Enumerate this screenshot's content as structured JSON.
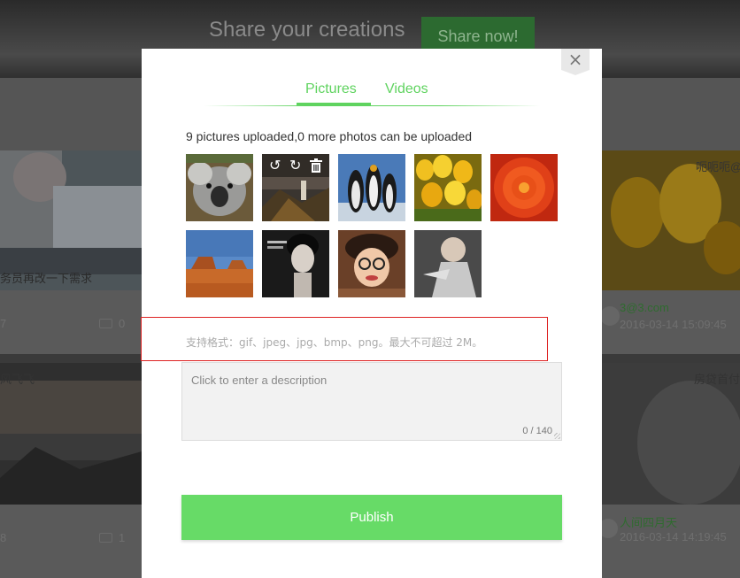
{
  "background": {
    "banner_title": "Share your creations",
    "banner_button": "Share now!",
    "card_left_top_caption": "务员再改一下需求",
    "card_left_top_comments": "0",
    "card_left_top_likes": "7",
    "card_right_top_tag": "呃呃呃@",
    "card_right_top_user": "3@3.com",
    "card_right_top_date": "2016-03-14 15:09:45",
    "card_left_bottom_tag": "风飞飞",
    "card_left_bottom_comments": "1",
    "card_left_bottom_likes": "8",
    "card_right_bottom_tag": "房贷首付",
    "card_right_bottom_user": "人间四月天",
    "card_right_bottom_date": "2016-03-14 14:19:45"
  },
  "modal": {
    "close_symbol": "×",
    "tabs": [
      {
        "label": "Pictures",
        "active": true
      },
      {
        "label": "Videos",
        "active": false
      }
    ],
    "upload_status": "9 pictures uploaded,0 more photos can be uploaded",
    "thumbnail_tools": {
      "rotate_left": "↺",
      "rotate_right": "↻",
      "delete": "🗑"
    },
    "thumbnails": [
      {
        "name": "koala"
      },
      {
        "name": "lighthouse"
      },
      {
        "name": "penguins"
      },
      {
        "name": "tulips"
      },
      {
        "name": "chrysanthemum"
      },
      {
        "name": "desert"
      },
      {
        "name": "portrait-woman"
      },
      {
        "name": "girl-with-glasses"
      },
      {
        "name": "woman-sparkle"
      }
    ],
    "format_hint": "支持格式：gif、jpeg、jpg、bmp、png。最大不可超过 2M。",
    "description_placeholder": "Click to enter a description",
    "description_count": "0 / 140",
    "publish_label": "Publish"
  },
  "colors": {
    "accent": "#5fd35f",
    "publish": "#67db67",
    "highlight_border": "#dd2222"
  }
}
